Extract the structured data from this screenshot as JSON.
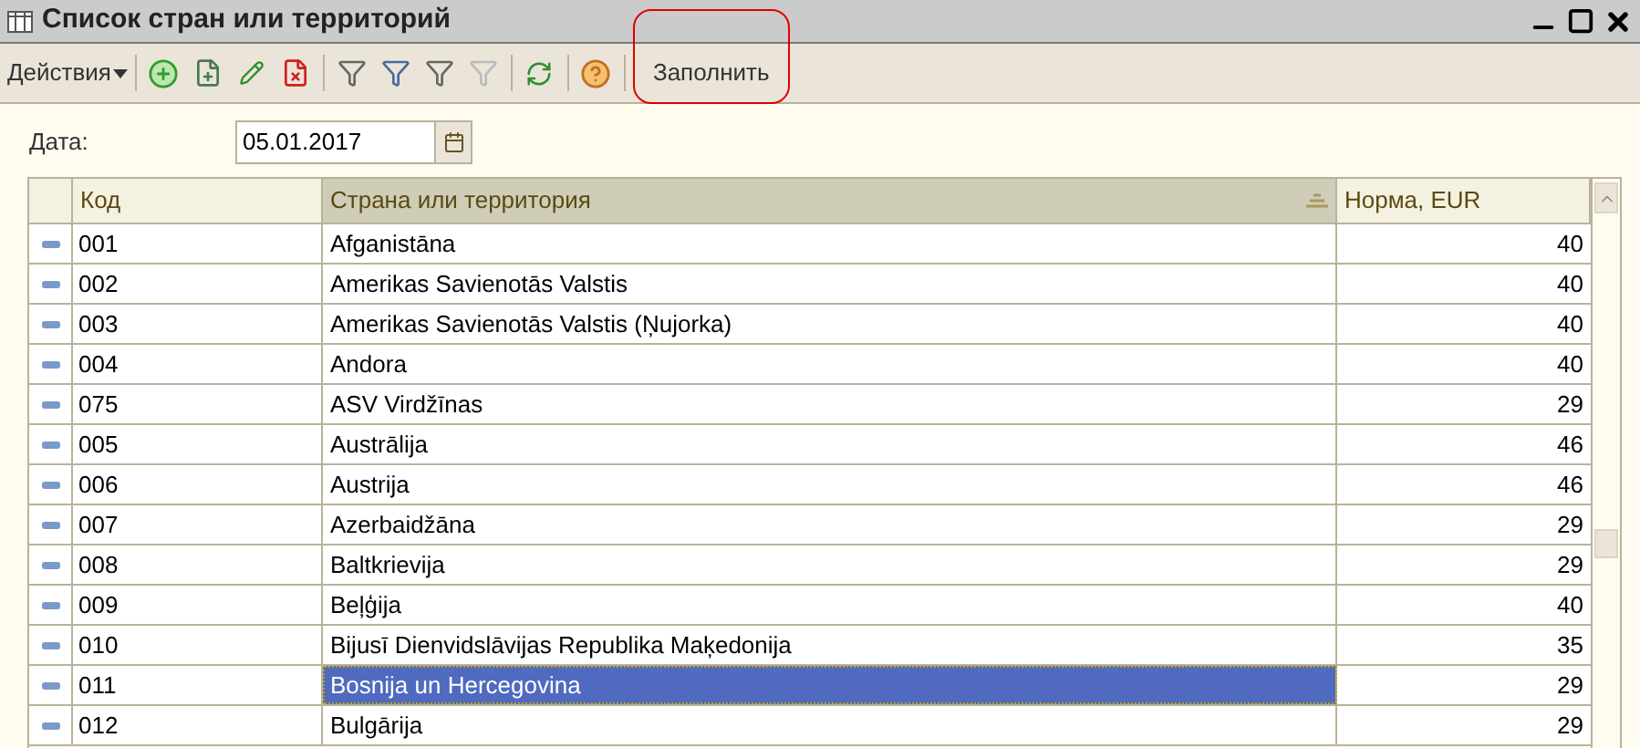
{
  "window": {
    "title": "Список стран или территорий"
  },
  "toolbar": {
    "actions_menu": "Действия",
    "fill_button": {
      "label": "Заполнить",
      "highlighted": true
    }
  },
  "date_field": {
    "label": "Дата:",
    "value": "05.01.2017"
  },
  "table": {
    "columns": [
      {
        "label": "Код",
        "sorted": false
      },
      {
        "label": "Страна или территория",
        "sorted": true
      },
      {
        "label": "Норма, EUR",
        "sorted": false
      }
    ],
    "rows": [
      {
        "code": "001",
        "name": "Afganistāna",
        "norm": "40",
        "selected": false
      },
      {
        "code": "002",
        "name": "Amerikas Savienotās Valstis",
        "norm": "40",
        "selected": false
      },
      {
        "code": "003",
        "name": "Amerikas Savienotās Valstis (Ņujorka)",
        "norm": "40",
        "selected": false
      },
      {
        "code": "004",
        "name": "Andora",
        "norm": "40",
        "selected": false
      },
      {
        "code": "075",
        "name": "ASV Virdžīnas",
        "norm": "29",
        "selected": false
      },
      {
        "code": "005",
        "name": "Austrālija",
        "norm": "46",
        "selected": false
      },
      {
        "code": "006",
        "name": "Austrija",
        "norm": "46",
        "selected": false
      },
      {
        "code": "007",
        "name": "Azerbaidžāna",
        "norm": "29",
        "selected": false
      },
      {
        "code": "008",
        "name": "Baltkrievija",
        "norm": "29",
        "selected": false
      },
      {
        "code": "009",
        "name": "Beļģija",
        "norm": "40",
        "selected": false
      },
      {
        "code": "010",
        "name": "Bijusī Dienvidslāvijas Republika Maķedonija",
        "norm": "35",
        "selected": false
      },
      {
        "code": "011",
        "name": "Bosnija un Hercegovina",
        "norm": "29",
        "selected": true
      },
      {
        "code": "012",
        "name": "Bulgārija",
        "norm": "29",
        "selected": false
      }
    ]
  }
}
